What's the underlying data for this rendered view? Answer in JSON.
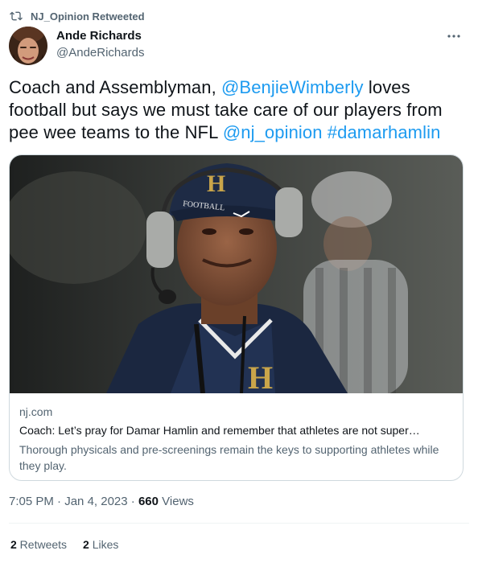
{
  "retweet": {
    "text": "NJ_Opinion Retweeted",
    "icon": "retweet-icon"
  },
  "author": {
    "name": "Ande Richards",
    "handle": "@AndeRichards",
    "avatar_icon": "avatar"
  },
  "tweet": {
    "text_1": "Coach and Assemblyman, ",
    "mention_1": "@BenjieWimberly",
    "text_2": " loves football but says we must take care of our players from pee wee teams to the NFL ",
    "mention_2": "@nj_opinion",
    "text_3": " ",
    "hashtag": "#damarhamlin"
  },
  "card": {
    "domain": "nj.com",
    "title": "Coach: Let’s pray for Damar Hamlin and remember that athletes are not super…",
    "description": "Thorough physicals and pre-screenings remain the keys to supporting athletes while they play.",
    "image_cap_letter": "H",
    "image_cap_word": "FOOTBALL",
    "image_shirt_letter": "H"
  },
  "meta": {
    "time": "7:05 PM",
    "sep1": " · ",
    "date": "Jan 4, 2023",
    "sep2": " · ",
    "views_count": "660",
    "views_label": " Views"
  },
  "stats": {
    "retweets_count": "2",
    "retweets_label": " Retweets",
    "likes_count": "2",
    "likes_label": " Likes"
  },
  "colors": {
    "link": "#1d9bf0",
    "secondary": "#536471",
    "primary": "#0f1419",
    "border": "#cfd9de"
  }
}
